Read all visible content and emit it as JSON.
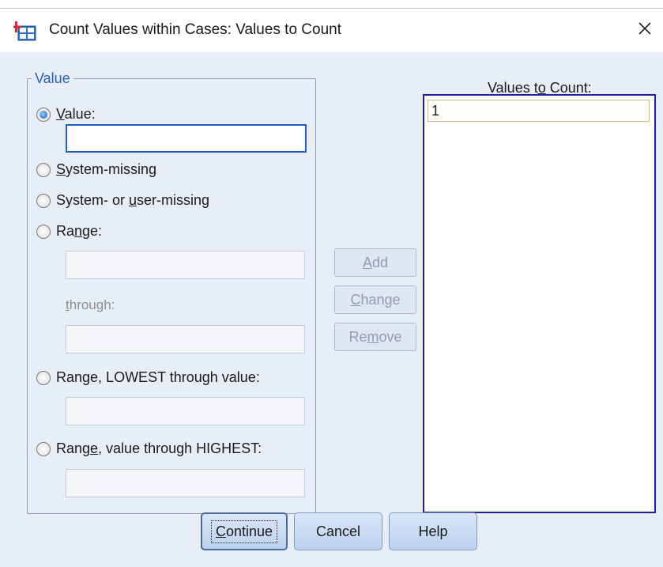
{
  "window": {
    "title": "Count Values within Cases: Values to Count",
    "icon": "spss-app-icon",
    "close_icon": "close-icon"
  },
  "value_group": {
    "legend": "Value",
    "options": [
      {
        "id": "value",
        "pre": "",
        "key": "V",
        "post": "alue:",
        "checked": true
      },
      {
        "id": "system-missing",
        "pre": "",
        "key": "S",
        "post": "ystem-missing",
        "checked": false
      },
      {
        "id": "system-or-user-missing",
        "pre": "System- or ",
        "key": "u",
        "post": "ser-missing",
        "checked": false
      },
      {
        "id": "range",
        "pre": "Ra",
        "key": "n",
        "post": "ge:",
        "checked": false
      },
      {
        "id": "range-lowest",
        "pre": "Ran",
        "key": "g",
        "post": "e, LOWEST through value:",
        "checked": false
      },
      {
        "id": "range-highest",
        "pre": "Rang",
        "key": "e",
        "post": ", value through HIGHEST:",
        "checked": false
      }
    ],
    "value_input": "",
    "range_from": "",
    "through_label_key": "t",
    "through_label_rest": "hrough:",
    "range_to": "",
    "lowest_value": "",
    "highest_value": ""
  },
  "side_buttons": [
    {
      "id": "add",
      "pre": "",
      "key": "A",
      "post": "dd",
      "enabled": false
    },
    {
      "id": "change",
      "pre": "",
      "key": "C",
      "post": "hange",
      "enabled": false
    },
    {
      "id": "remove",
      "pre": "Re",
      "key": "m",
      "post": "ove",
      "enabled": false
    }
  ],
  "values_list": {
    "label_pre": "Values t",
    "label_key": "o",
    "label_post": " Count:",
    "items": [
      "1"
    ]
  },
  "bottom_buttons": [
    {
      "id": "continue",
      "pre": "",
      "key": "C",
      "post": "ontinue",
      "default": true
    },
    {
      "id": "cancel",
      "label": "Cancel"
    },
    {
      "id": "help",
      "label": "Help"
    }
  ],
  "colors": {
    "dialog_bg": "#e8eef8",
    "legend_text": "#2660b8",
    "list_border": "#1f1fa8",
    "disabled_text": "#8f9cb1"
  }
}
